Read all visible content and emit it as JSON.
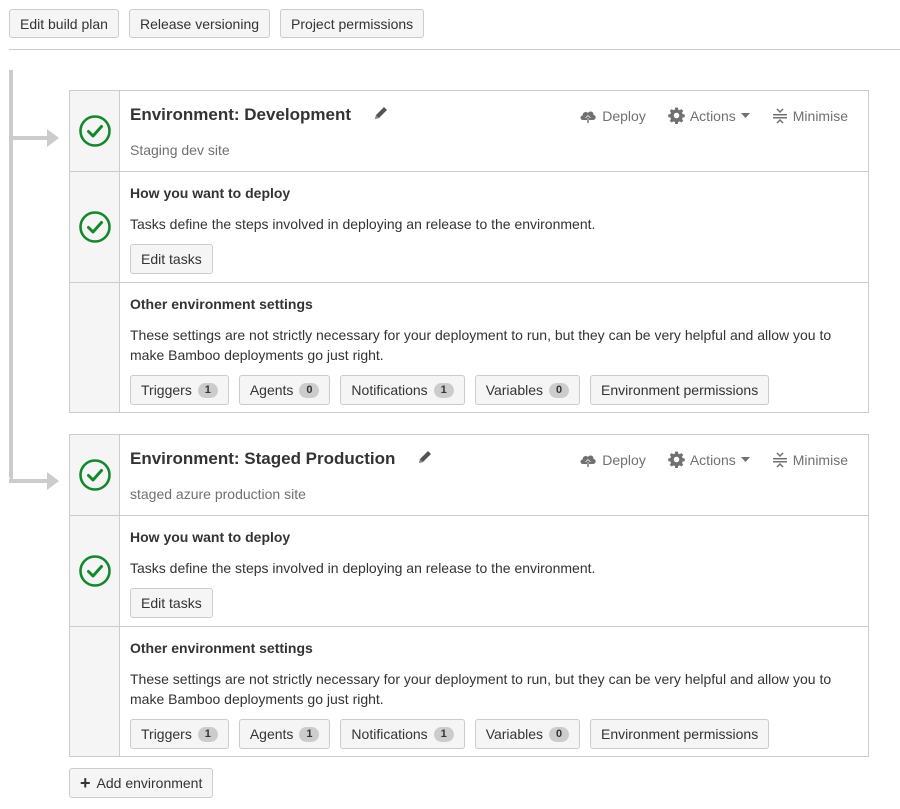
{
  "toolbar": {
    "edit_build_plan": "Edit build plan",
    "release_versioning": "Release versioning",
    "project_permissions": "Project permissions"
  },
  "colors": {
    "success": "#14892c",
    "border": "#cccccc",
    "muted": "#707070"
  },
  "icons": {
    "status": "check-circle-icon",
    "edit": "pencil-icon",
    "deploy": "cloud-upload-icon",
    "actions": "gear-icon",
    "minimise": "collapse-icon",
    "add": "plus-icon"
  },
  "environments": [
    {
      "title": "Environment: Development",
      "description": "Staging dev site",
      "actions": {
        "deploy": "Deploy",
        "actions": "Actions",
        "minimise": "Minimise"
      },
      "deploy_section": {
        "title": "How you want to deploy",
        "text": "Tasks define the steps involved in deploying an release to the environment.",
        "button": "Edit tasks"
      },
      "settings_section": {
        "title": "Other environment settings",
        "text": "These settings are not strictly necessary for your deployment to run, but they can be very helpful and allow you to make Bamboo deployments go just right.",
        "buttons": [
          {
            "label": "Triggers",
            "count": "1"
          },
          {
            "label": "Agents",
            "count": "0"
          },
          {
            "label": "Notifications",
            "count": "1"
          },
          {
            "label": "Variables",
            "count": "0"
          },
          {
            "label": "Environment permissions"
          }
        ]
      }
    },
    {
      "title": "Environment: Staged Production",
      "description": "staged azure production site",
      "actions": {
        "deploy": "Deploy",
        "actions": "Actions",
        "minimise": "Minimise"
      },
      "deploy_section": {
        "title": "How you want to deploy",
        "text": "Tasks define the steps involved in deploying an release to the environment.",
        "button": "Edit tasks"
      },
      "settings_section": {
        "title": "Other environment settings",
        "text": "These settings are not strictly necessary for your deployment to run, but they can be very helpful and allow you to make Bamboo deployments go just right.",
        "buttons": [
          {
            "label": "Triggers",
            "count": "1"
          },
          {
            "label": "Agents",
            "count": "1"
          },
          {
            "label": "Notifications",
            "count": "1"
          },
          {
            "label": "Variables",
            "count": "0"
          },
          {
            "label": "Environment permissions"
          }
        ]
      }
    }
  ],
  "add_environment": "Add environment"
}
